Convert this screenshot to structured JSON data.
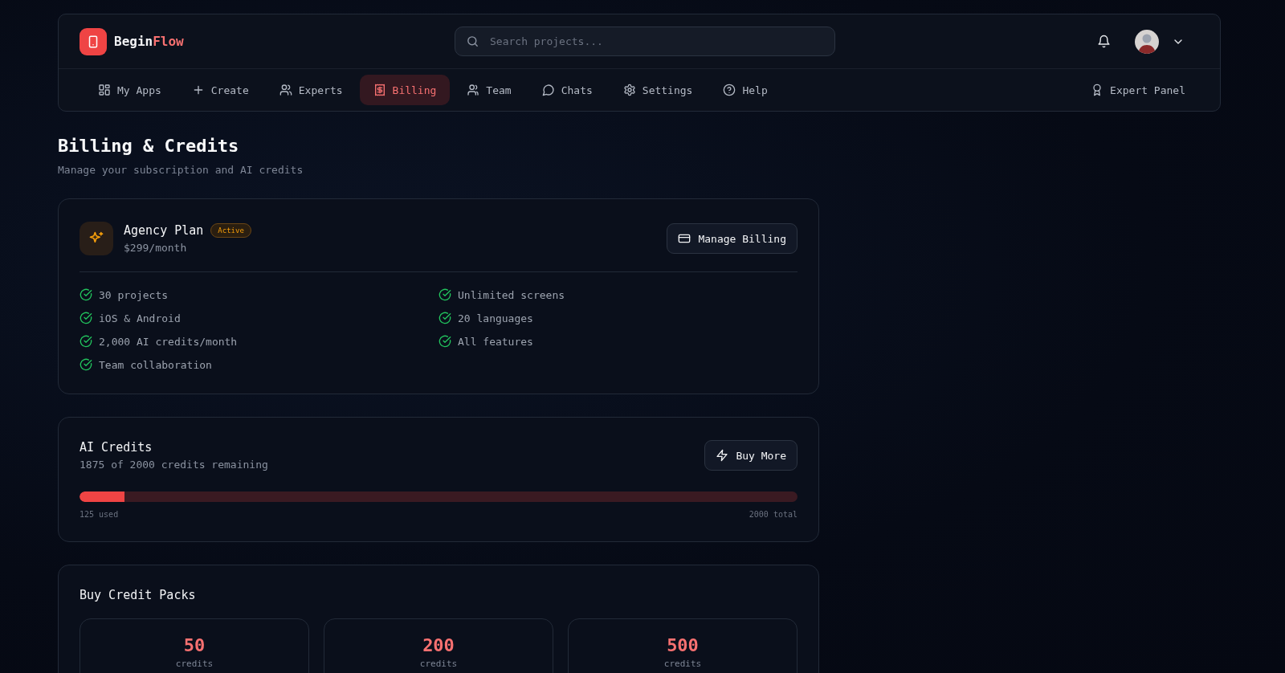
{
  "header": {
    "logo": {
      "part1": "Begin",
      "part2": "Flow"
    },
    "search": {
      "placeholder": "Search projects..."
    }
  },
  "nav": [
    {
      "label": "My Apps",
      "selected": false
    },
    {
      "label": "Create",
      "selected": false
    },
    {
      "label": "Experts",
      "selected": false
    },
    {
      "label": "Billing",
      "selected": true
    },
    {
      "label": "Team",
      "selected": false
    },
    {
      "label": "Chats",
      "selected": false
    },
    {
      "label": "Settings",
      "selected": false
    },
    {
      "label": "Help",
      "selected": false
    }
  ],
  "nav_right": {
    "label": "Expert Panel"
  },
  "page": {
    "title": "Billing & Credits",
    "subtitle": "Manage your subscription and AI credits"
  },
  "plan": {
    "name": "Agency Plan",
    "badge": "Active",
    "price": "$299/month",
    "button": "Manage Billing",
    "features": [
      "30 projects",
      "Unlimited screens",
      "iOS & Android",
      "20 languages",
      "2,000 AI credits/month",
      "All features",
      "Team collaboration"
    ]
  },
  "credits": {
    "title": "AI Credits",
    "subtitle": "1875 of 2000 credits remaining",
    "button": "Buy More",
    "level": 0.0625,
    "used": "125 used",
    "total": "2000 total"
  },
  "packs": {
    "title": "Buy Credit Packs",
    "items": [
      {
        "amount": "50",
        "unit": "credits"
      },
      {
        "amount": "200",
        "unit": "credits"
      },
      {
        "amount": "500",
        "unit": "credits"
      }
    ]
  }
}
